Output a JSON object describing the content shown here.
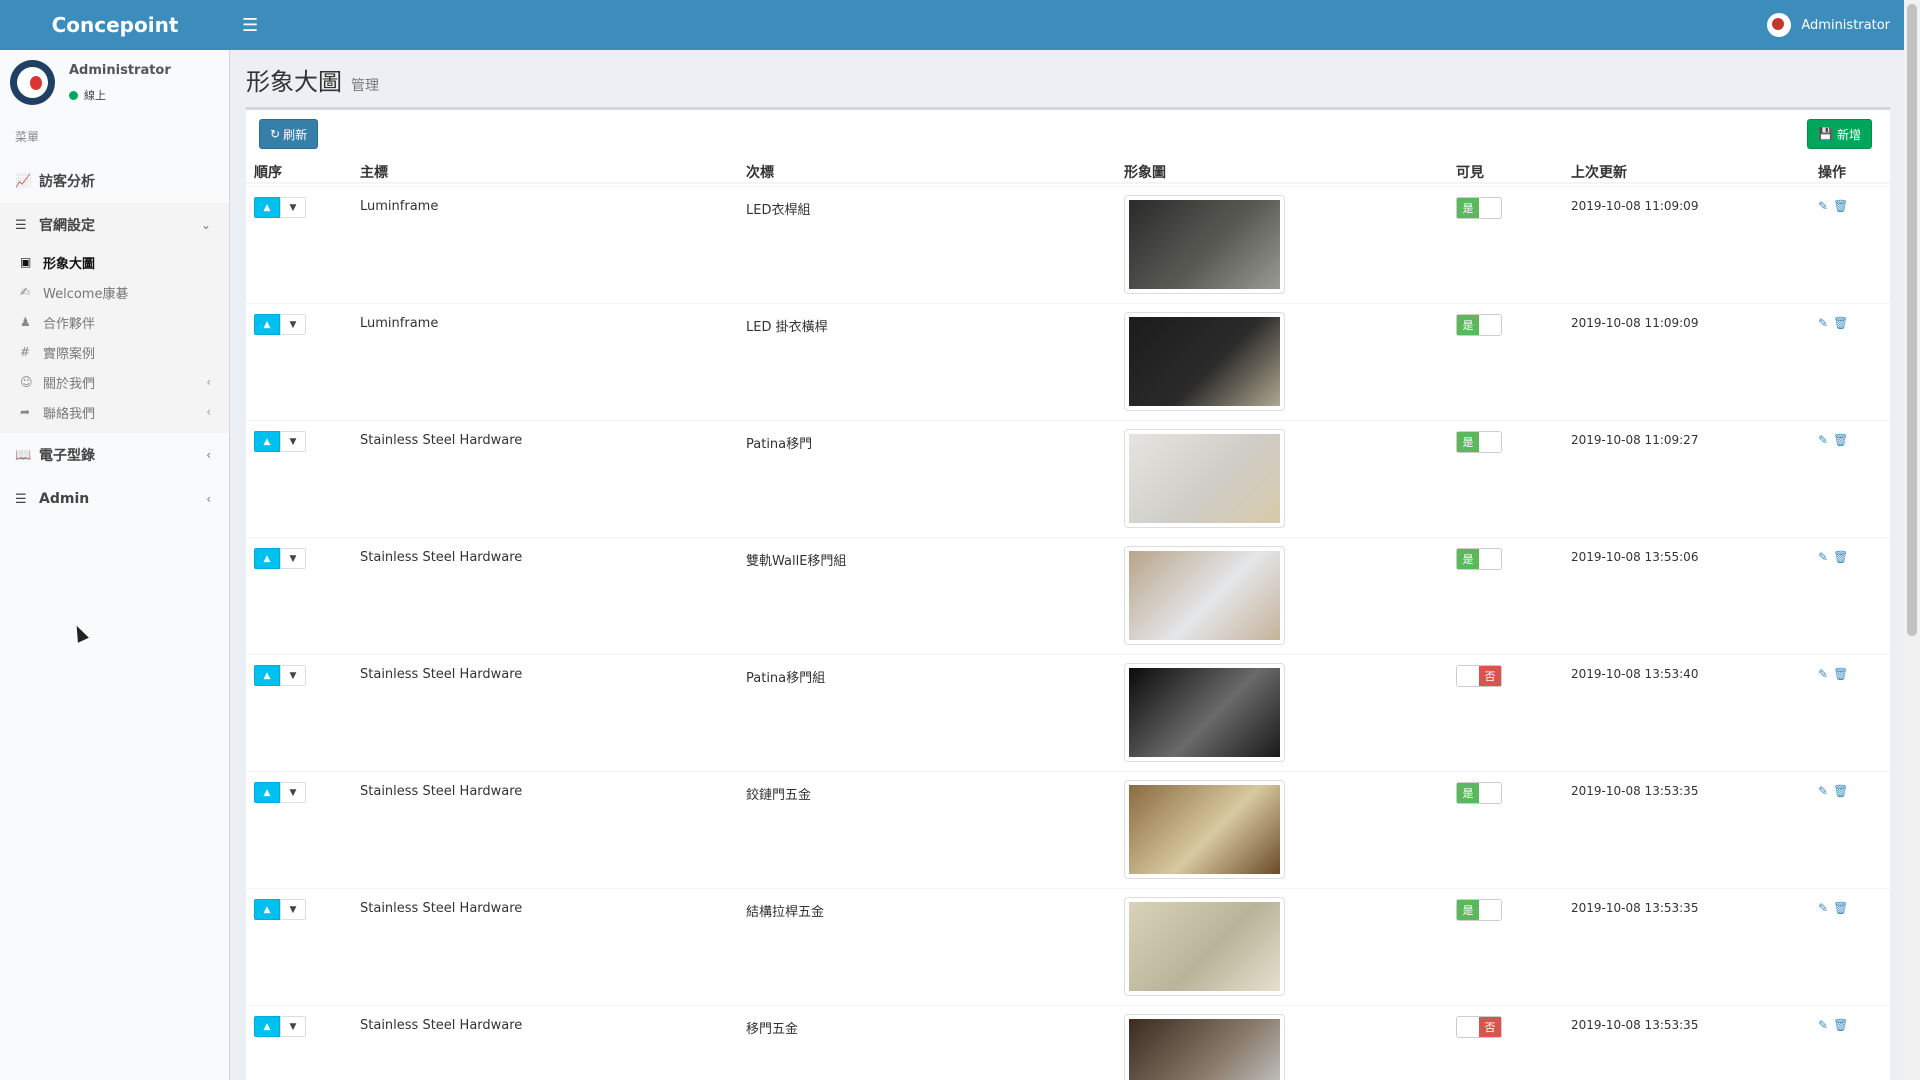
{
  "app": {
    "brand": "Concepoint",
    "menu_toggle_icon": "hamburger-icon",
    "top_user": "Administrator"
  },
  "sidebar": {
    "user_name": "Administrator",
    "status": "線上",
    "menu_header": "菜單",
    "items": [
      {
        "label": "訪客分析",
        "icon": "line-chart-icon"
      },
      {
        "label": "官網設定",
        "icon": "bars-icon",
        "caret": "chevron-down-icon",
        "children": [
          {
            "label": "形象大圖",
            "icon": "image-icon",
            "active": true
          },
          {
            "label": "Welcome康碁",
            "icon": "hand-icon"
          },
          {
            "label": "合作夥伴",
            "icon": "users-icon"
          },
          {
            "label": "實際案例",
            "icon": "hashtag-icon"
          },
          {
            "label": "關於我們",
            "icon": "smile-icon",
            "caret": "chevron-left-icon"
          },
          {
            "label": "聯絡我們",
            "icon": "share-icon",
            "caret": "chevron-left-icon"
          }
        ]
      },
      {
        "label": "電子型錄",
        "icon": "book-icon",
        "caret": "chevron-left-icon"
      },
      {
        "label": "Admin",
        "icon": "list-icon",
        "caret": "chevron-left-icon"
      }
    ]
  },
  "page": {
    "title": "形象大圖",
    "subtitle": "管理",
    "refresh_label": "刷新",
    "add_label": "新增"
  },
  "table": {
    "headers": [
      "順序",
      "主標",
      "次標",
      "形象圖",
      "可見",
      "上次更新",
      "操作"
    ],
    "rows": [
      {
        "main": "Luminframe",
        "sub": "LED衣桿組",
        "visible": "是",
        "on": true,
        "updated": "2019-10-08 11:09:09",
        "thumb": [
          "#2a2a2a",
          "#5a5a55",
          "#9a9a95"
        ]
      },
      {
        "main": "Luminframe",
        "sub": "LED 掛衣橫桿",
        "visible": "是",
        "on": true,
        "updated": "2019-10-08 11:09:09",
        "thumb": [
          "#1c1c1c",
          "#2a2a2a",
          "#b0a890"
        ]
      },
      {
        "main": "Stainless Steel Hardware",
        "sub": "Patina移門",
        "visible": "是",
        "on": true,
        "updated": "2019-10-08 11:09:27",
        "thumb": [
          "#e6e4e0",
          "#cfcdc8",
          "#d8c9a8"
        ]
      },
      {
        "main": "Stainless Steel Hardware",
        "sub": "雙軌WallE移門組",
        "visible": "是",
        "on": true,
        "updated": "2019-10-08 13:55:06",
        "thumb": [
          "#b8a48a",
          "#e4e6e8",
          "#c4b29a"
        ]
      },
      {
        "main": "Stainless Steel Hardware",
        "sub": "Patina移門組",
        "visible": "否",
        "on": false,
        "updated": "2019-10-08 13:53:40",
        "thumb": [
          "#0a0a0a",
          "#6a6a6a",
          "#1a1a1a"
        ]
      },
      {
        "main": "Stainless Steel Hardware",
        "sub": "鉸鏈門五金",
        "visible": "是",
        "on": true,
        "updated": "2019-10-08 13:53:35",
        "thumb": [
          "#8a6a40",
          "#d8c9a0",
          "#6a4a28"
        ]
      },
      {
        "main": "Stainless Steel Hardware",
        "sub": "結構拉桿五金",
        "visible": "是",
        "on": true,
        "updated": "2019-10-08 13:53:35",
        "thumb": [
          "#d8d2b8",
          "#b8b49a",
          "#e4e0cc"
        ]
      },
      {
        "main": "Stainless Steel Hardware",
        "sub": "移門五金",
        "visible": "否",
        "on": false,
        "updated": "2019-10-08 13:53:35",
        "thumb": [
          "#3a2a20",
          "#8a7a6a",
          "#cfd4d8"
        ]
      }
    ]
  },
  "colors": {
    "topbar": "#3c8dbc",
    "on": "#5cb85c",
    "off": "#d9534f",
    "add": "#00a65a",
    "order_up": "#00c0ef"
  }
}
